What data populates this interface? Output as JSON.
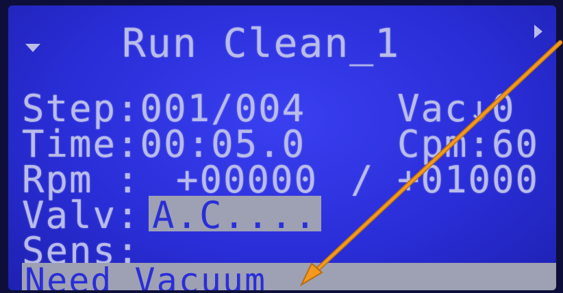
{
  "screen": {
    "title": "Run Clean_1",
    "rows": {
      "step": "Step:001/004",
      "vac": "Vac↓0",
      "time": "Time:00:05.0",
      "cpm": "Cpm:60",
      "rpm_label": "Rpm :",
      "rpm_actual": "+00000",
      "rpm_sep": "/",
      "rpm_target": "+01000",
      "valv_label": "Valv:",
      "valv_value": "A.C....",
      "sens_label": "Sens:",
      "status": "Need Vacuum"
    },
    "icons": [
      "down-triangle-icon",
      "right-triangle-icon"
    ]
  },
  "colors": {
    "lcd_bg": "#2a2ed8",
    "lcd_text": "#b9bce8",
    "highlight": "#9ea0b4",
    "annotation_arrow": "#f39a1e"
  }
}
